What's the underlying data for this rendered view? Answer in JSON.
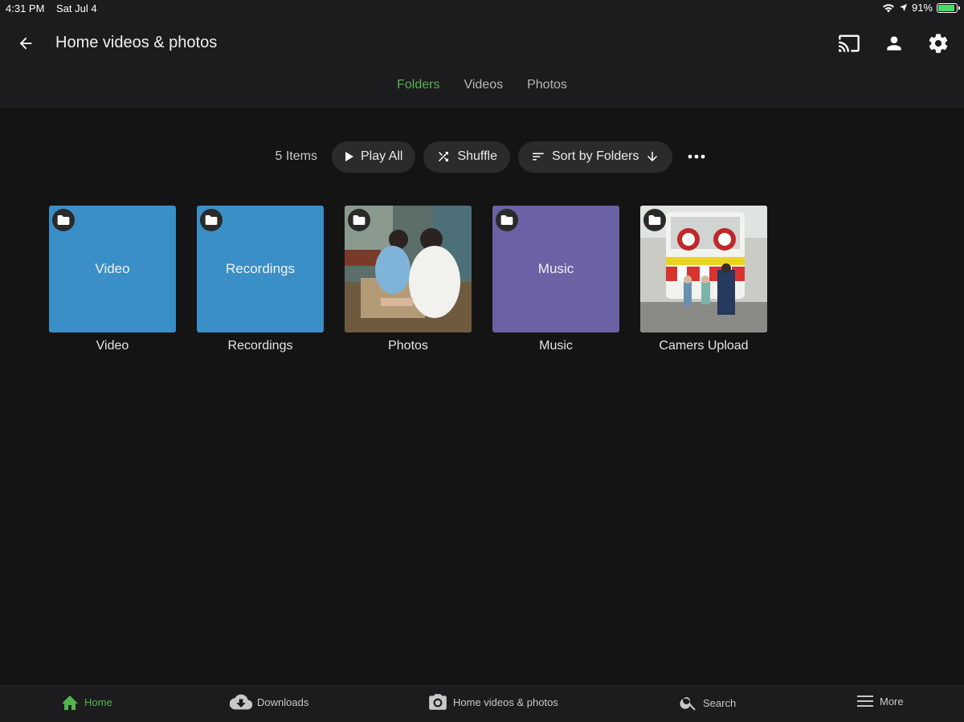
{
  "status": {
    "time": "4:31 PM",
    "date": "Sat Jul 4",
    "battery": "91%",
    "battery_level": 0.91
  },
  "header": {
    "title": "Home videos & photos"
  },
  "tabs": [
    {
      "label": "Folders",
      "active": true
    },
    {
      "label": "Videos",
      "active": false
    },
    {
      "label": "Photos",
      "active": false
    }
  ],
  "toolbar": {
    "count": "5 Items",
    "play_all": "Play All",
    "shuffle": "Shuffle",
    "sort": "Sort by Folders"
  },
  "folders": [
    {
      "title": "Video",
      "center_label": "Video",
      "color": "#3a8fc7"
    },
    {
      "title": "Recordings",
      "center_label": "Recordings",
      "color": "#3a8fc7"
    },
    {
      "title": "Photos",
      "center_label": "",
      "color": "#6f5c4e"
    },
    {
      "title": "Music",
      "center_label": "Music",
      "color": "#6a62a5"
    },
    {
      "title": "Camers Upload",
      "center_label": "",
      "color": "#9a9a96"
    }
  ],
  "nav": {
    "home": "Home",
    "downloads": "Downloads",
    "library": "Home videos & photos",
    "search": "Search",
    "more": "More"
  },
  "colors": {
    "accent": "#52b54b",
    "background": "#141414",
    "bar": "#1c1c1e"
  }
}
